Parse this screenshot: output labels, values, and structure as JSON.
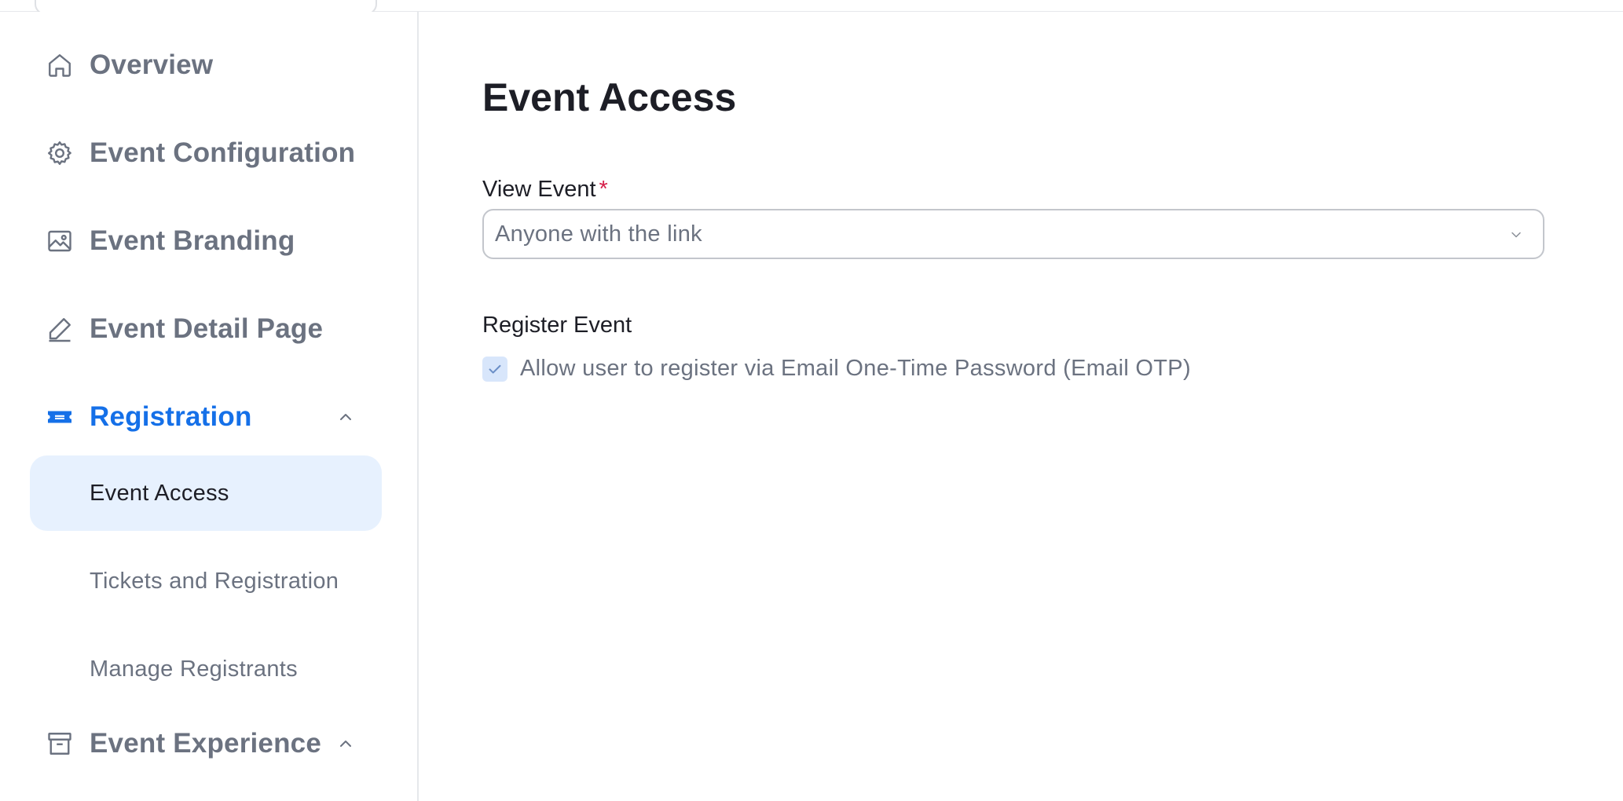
{
  "sidebar": {
    "items": [
      {
        "label": "Overview",
        "icon": "home-icon"
      },
      {
        "label": "Event Configuration",
        "icon": "gear-icon"
      },
      {
        "label": "Event Branding",
        "icon": "image-icon"
      },
      {
        "label": "Event Detail Page",
        "icon": "pencil-icon"
      },
      {
        "label": "Registration",
        "icon": "ticket-icon",
        "expanded": true,
        "active": true
      },
      {
        "label": "Event Experience",
        "icon": "store-icon",
        "expanded": true
      }
    ],
    "registration_sub_items": [
      {
        "label": "Event Access",
        "selected": true
      },
      {
        "label": "Tickets and Registration"
      },
      {
        "label": "Manage Registrants"
      }
    ]
  },
  "main": {
    "title": "Event Access",
    "view_event": {
      "label": "View Event",
      "required_mark": "*",
      "value": "Anyone with the link"
    },
    "register_event": {
      "label": "Register Event",
      "checkbox_label": "Allow user to register via Email One-Time Password (Email OTP)",
      "checked": true
    }
  },
  "colors": {
    "accent": "#1570e8",
    "selected_bg": "#e7f1fe",
    "muted_text": "#6b7280",
    "required": "#d6204a"
  }
}
